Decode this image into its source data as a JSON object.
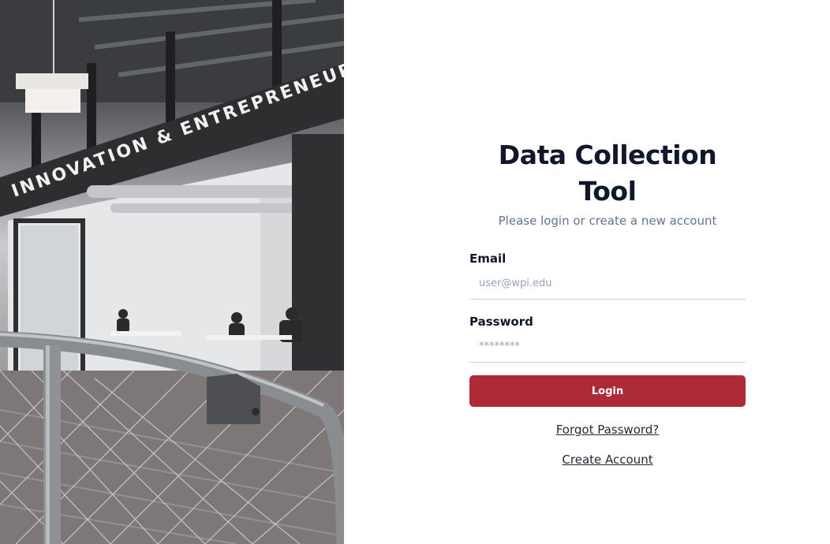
{
  "photo": {
    "sign_text": "INNOVATION & ENTREPRENEURSHIP"
  },
  "form": {
    "title": "Data Collection Tool",
    "subtitle": "Please login or create a new account",
    "email_label": "Email",
    "email_placeholder": "user@wpi.edu",
    "password_label": "Password",
    "password_placeholder": "********",
    "login_label": "Login",
    "forgot_password_label": "Forgot Password?",
    "create_account_label": "Create Account"
  },
  "colors": {
    "primary": "#ac2b37",
    "title": "#0f172a",
    "subtitle": "#64748b"
  }
}
